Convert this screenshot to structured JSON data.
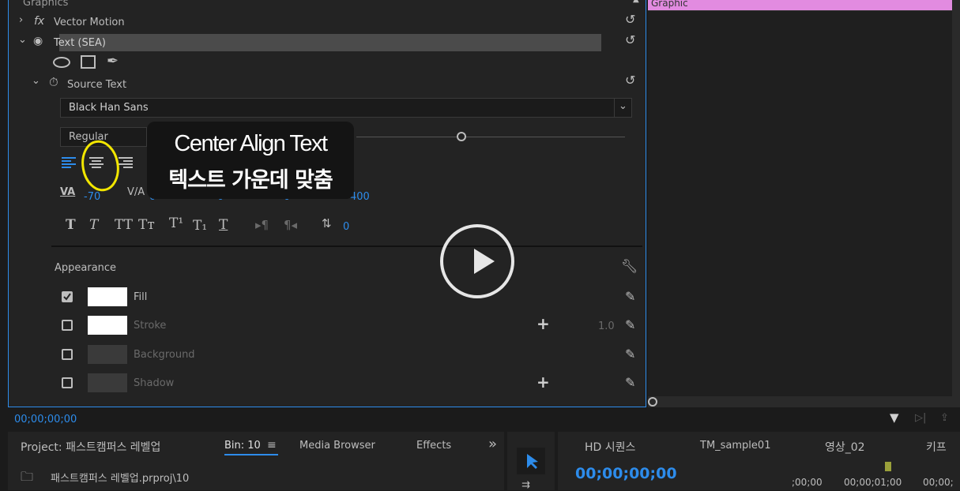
{
  "effect_controls": {
    "section_label": "Graphics",
    "vector_motion_label": "Vector Motion",
    "text_layer_label": "Text (SEA)",
    "source_text_label": "Source Text",
    "font_family": "Black Han Sans",
    "font_style": "Regular",
    "tracking_value": "-70",
    "leading_value": "0",
    "baseline_value": "0",
    "tsume_value": "0",
    "size_value": "400",
    "indent_value": "0",
    "appearance_label": "Appearance",
    "fill_label": "Fill",
    "stroke_label": "Stroke",
    "stroke_width": "1.0",
    "background_label": "Background",
    "shadow_label": "Shadow",
    "timecode": "00;00;00;00"
  },
  "tooltip": {
    "line1": "Center Align Text",
    "line2": "텍스트 가운데 맞춤"
  },
  "timeline": {
    "clip_label": "Graphic"
  },
  "project_panel": {
    "project_tab": "Project: 패스트캠퍼스 레벨업",
    "bin_tab": "Bin: 10",
    "media_browser_tab": "Media Browser",
    "effects_tab": "Effects",
    "more": "»",
    "path": "패스트캠퍼스 레벨업.prproj\\10"
  },
  "sequence_panel": {
    "tab1": "HD 시퀀스",
    "tab2": "TM_sample01",
    "tab3": "영상_02",
    "tab4": "키프",
    "timecode": "00;00;00;00",
    "ruler_0": ";00;00",
    "ruler_1": "00;00;01;00",
    "ruler_2": "00;00;"
  },
  "colors": {
    "accent": "#2d8ceb",
    "tooltip_highlight": "#f2e600",
    "clip_pink": "#e28be0"
  }
}
